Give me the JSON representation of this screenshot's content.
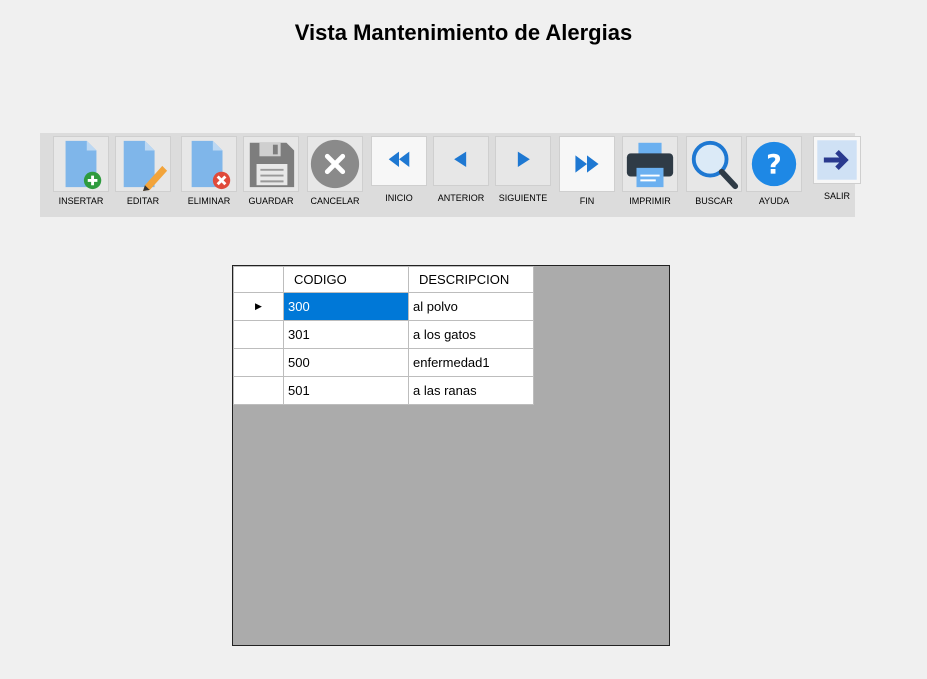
{
  "title": "Vista Mantenimiento de Alergias",
  "toolbar": {
    "buttons": [
      {
        "label": "INSERTAR",
        "icon": "insert-document-icon"
      },
      {
        "label": "EDITAR",
        "icon": "edit-document-icon"
      },
      {
        "label": "ELIMINAR",
        "icon": "delete-document-icon"
      },
      {
        "label": "GUARDAR",
        "icon": "save-icon"
      },
      {
        "label": "CANCELAR",
        "icon": "cancel-icon"
      },
      {
        "label": "INICIO",
        "icon": "first-icon"
      },
      {
        "label": "ANTERIOR",
        "icon": "previous-icon"
      },
      {
        "label": "SIGUIENTE",
        "icon": "next-icon"
      },
      {
        "label": "FIN",
        "icon": "last-icon"
      },
      {
        "label": "IMPRIMIR",
        "icon": "printer-icon"
      },
      {
        "label": "BUSCAR",
        "icon": "search-icon"
      },
      {
        "label": "AYUDA",
        "icon": "help-icon"
      },
      {
        "label": "SALIR",
        "icon": "exit-icon"
      }
    ]
  },
  "grid": {
    "columns": [
      "CODIGO",
      "DESCRIPCION"
    ],
    "rows": [
      {
        "codigo": "300",
        "descripcion": "al polvo"
      },
      {
        "codigo": "301",
        "descripcion": "a los gatos"
      },
      {
        "codigo": "500",
        "descripcion": "enfermedad1"
      },
      {
        "codigo": "501",
        "descripcion": "a las ranas"
      }
    ],
    "current_row_marker": "▶"
  }
}
